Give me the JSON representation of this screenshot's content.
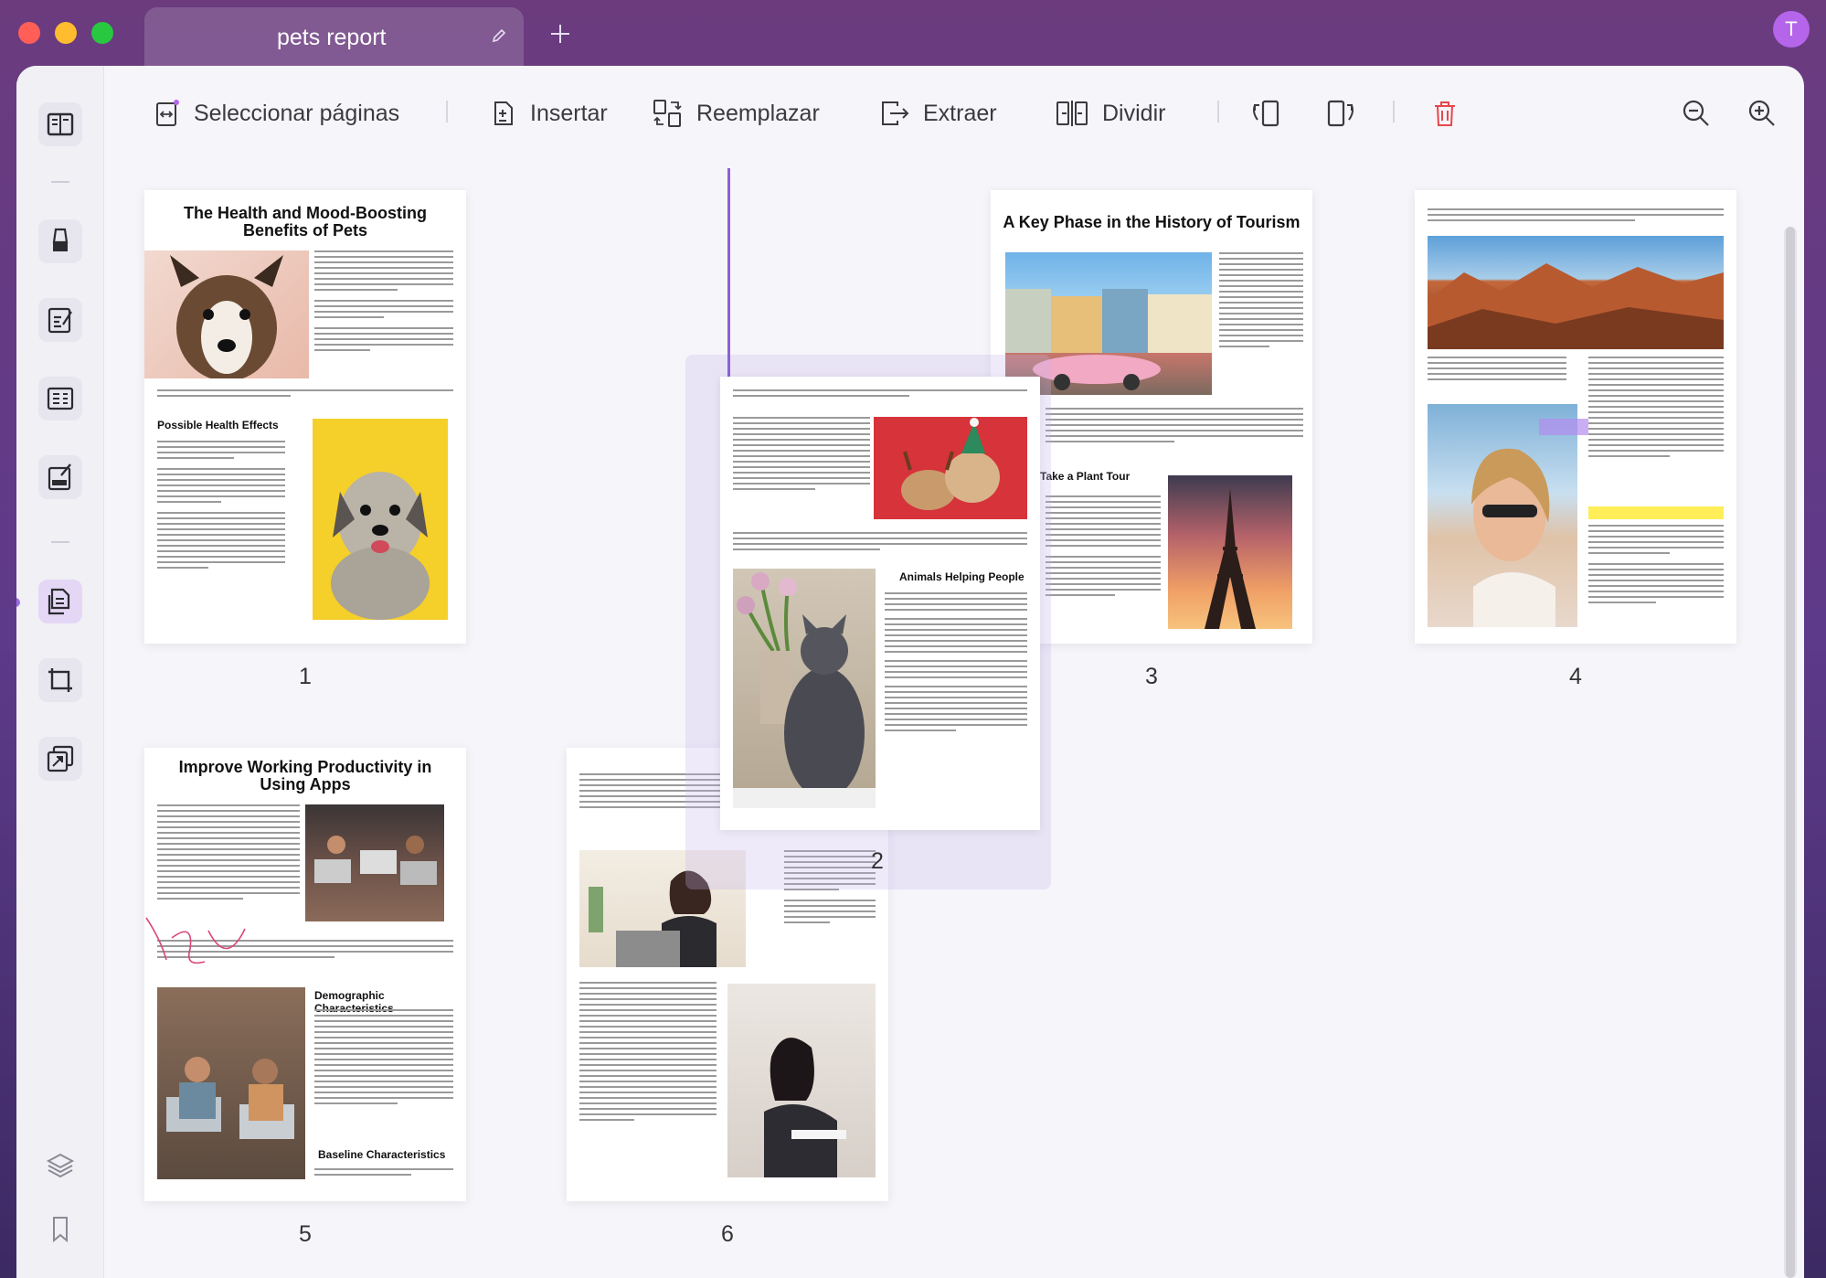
{
  "window": {
    "tab_title": "pets report",
    "avatar_letter": "T"
  },
  "toolbar": {
    "select_pages": "Seleccionar páginas",
    "insert": "Insertar",
    "replace": "Reemplazar",
    "extract": "Extraer",
    "split": "Dividir"
  },
  "pages": [
    {
      "number": "1",
      "title": "The Health and Mood-Boosting Benefits of Pets",
      "heading": "Possible Health Effects"
    },
    {
      "number": "2",
      "heading": "Animals Helping People"
    },
    {
      "number": "3",
      "title": "A Key Phase in the History of Tourism",
      "heading": "Take a Plant Tour"
    },
    {
      "number": "4"
    },
    {
      "number": "5",
      "title": "Improve Working Productivity in Using Apps",
      "heading": "Demographic Characteristics",
      "heading2": "Baseline Characteristics"
    },
    {
      "number": "6"
    }
  ],
  "colors": {
    "accent": "#8b61d6",
    "delete": "#e5484d",
    "avatar": "#b565ea"
  }
}
